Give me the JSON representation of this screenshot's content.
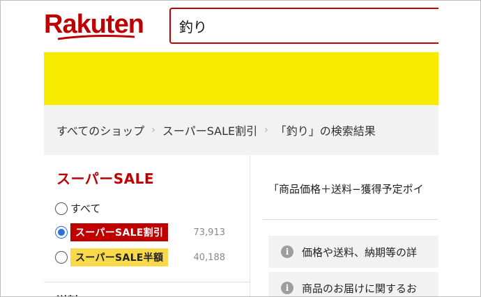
{
  "header": {
    "logo_text": "Rakuten",
    "search_value": "釣り"
  },
  "breadcrumb": {
    "items": [
      "すべてのショップ",
      "スーパーSALE割引",
      "「釣り」の検索結果"
    ],
    "separator": "›"
  },
  "sidebar": {
    "title": "スーパーSALE",
    "options": [
      {
        "label": "すべて",
        "count": "",
        "selected": false
      },
      {
        "label": "スーパーSALE割引",
        "count": "73,913",
        "selected": true
      },
      {
        "label": "スーパーSALE半額",
        "count": "40,188",
        "selected": false
      }
    ],
    "next_section_partial": "送料"
  },
  "main": {
    "sort_text": "「商品価格＋送料−獲得予定ポイ",
    "notices": [
      "価格や送料、納期等の詳",
      "商品のお届けに関するお"
    ],
    "info_icon_glyph": "i"
  },
  "colors": {
    "brand_red": "#bf0000",
    "banner_yellow": "#f7ec00",
    "badge_yellow": "#f7d94a",
    "radio_blue": "#2f6fe0"
  },
  "icons": {
    "logo": "rakuten-logo",
    "info": "info-icon",
    "radio": "radio-icon"
  }
}
